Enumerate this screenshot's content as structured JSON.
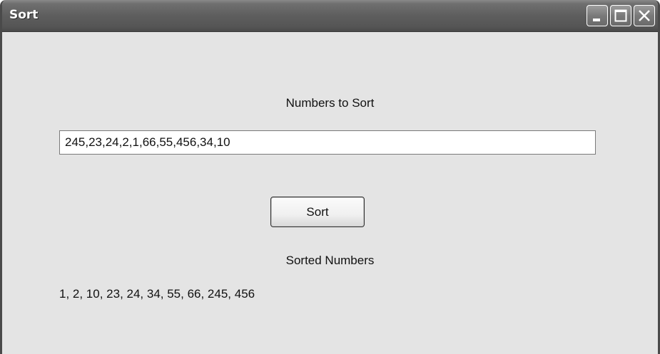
{
  "window": {
    "title": "Sort",
    "controls": {
      "minimize_icon": "minimize-icon",
      "maximize_icon": "maximize-icon",
      "close_icon": "close-icon"
    }
  },
  "form": {
    "numbers_label": "Numbers to Sort",
    "numbers_input_value": "245,23,24,2,1,66,55,456,34,10",
    "sort_button_label": "Sort",
    "sorted_label": "Sorted Numbers",
    "sorted_result": "1, 2, 10, 23, 24, 34, 55, 66, 245, 456"
  },
  "colors": {
    "titlebar": "#5e5e5e",
    "window_background": "#e4e4e4",
    "title_text": "#ffffff"
  }
}
